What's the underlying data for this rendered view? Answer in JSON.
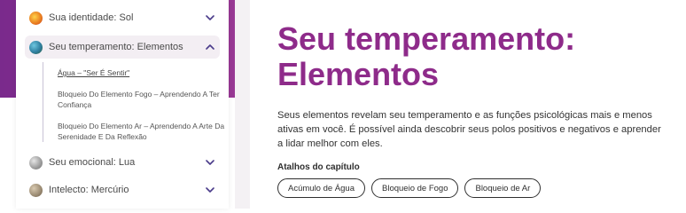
{
  "sidebar": {
    "items": [
      {
        "label": "Sua identidade: Sol",
        "icon": "sun-icon"
      },
      {
        "label": "Seu temperamento: Elementos",
        "icon": "earth-icon"
      },
      {
        "label": "Seu emocional: Lua",
        "icon": "moon-icon"
      },
      {
        "label": "Intelecto: Mercúrio",
        "icon": "mercury-icon"
      }
    ],
    "sub_links": [
      "Água – \"Ser É Sentir\"",
      "Bloqueio Do Elemento Fogo – Aprendendo A Ter Confiança",
      "Bloqueio Do Elemento Ar – Aprendendo A Arte Da Serenidade E Da Reflexão"
    ]
  },
  "main": {
    "title": "Seu temperamento: Elementos",
    "description": "Seus elementos revelam seu temperamento e as funções psicológicas mais e menos ativas em você. É possível ainda descobrir seus polos positivos e negativos e aprender a lidar melhor com eles.",
    "shortcuts_title": "Atalhos do capítulo",
    "chips": [
      "Acúmulo de Água",
      "Bloqueio de Fogo",
      "Bloqueio de Ar"
    ]
  },
  "colors": {
    "brand_purple": "#8e2b8a",
    "band_purple": "#7a2a8c",
    "chevron": "#4a3b8a"
  }
}
